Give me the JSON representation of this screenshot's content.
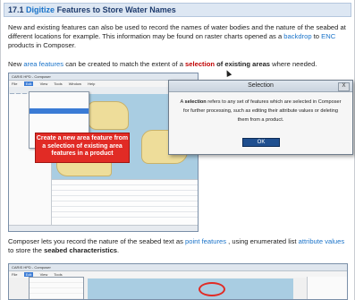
{
  "heading": {
    "number": "17.1",
    "highlight": "Digitize",
    "rest": "Features to Store Water Names"
  },
  "para1": {
    "text1": "New and existing features can also be used to record the names of water bodies and the nature of the seabed at different locations for example. This information may be found on raster charts opened as a",
    "link1": "backdrop",
    "text2": "to",
    "link2": "ENC",
    "text3": "products in Composer."
  },
  "para2": {
    "text1": "New",
    "link1": "area features",
    "text2": "can be created to match the extent of a",
    "red": "selection",
    "bold": "of existing areas",
    "text3": "where needed."
  },
  "screenshot1": {
    "window_title": "CARIS HPD - Composer",
    "menu": [
      "File",
      "Edit",
      "View",
      "Tools",
      "Window",
      "Help"
    ],
    "callout": "Create a new area feature from a selection of existing area features in a product"
  },
  "dialog": {
    "title": "Selection",
    "close": "X",
    "body_prefix": "A",
    "body_bold": "selection",
    "body_rest": "refers to any set of features which are selected in Composer for further processing, such as editing their attribute values or deleting them from a product.",
    "ok": "OK"
  },
  "para3": {
    "text1": "Composer lets you record the nature of the seabed text as",
    "link1": "point features",
    "text2": ", using enumerated list",
    "link2": "attribute values",
    "text3": "to store the",
    "bold": "seabed characteristics",
    "text4": "."
  },
  "colors": {
    "link": "#1a73c9",
    "callout": "#e12b25",
    "heading_bg": "#dde7f3",
    "ok_button": "#1f4f8f"
  }
}
